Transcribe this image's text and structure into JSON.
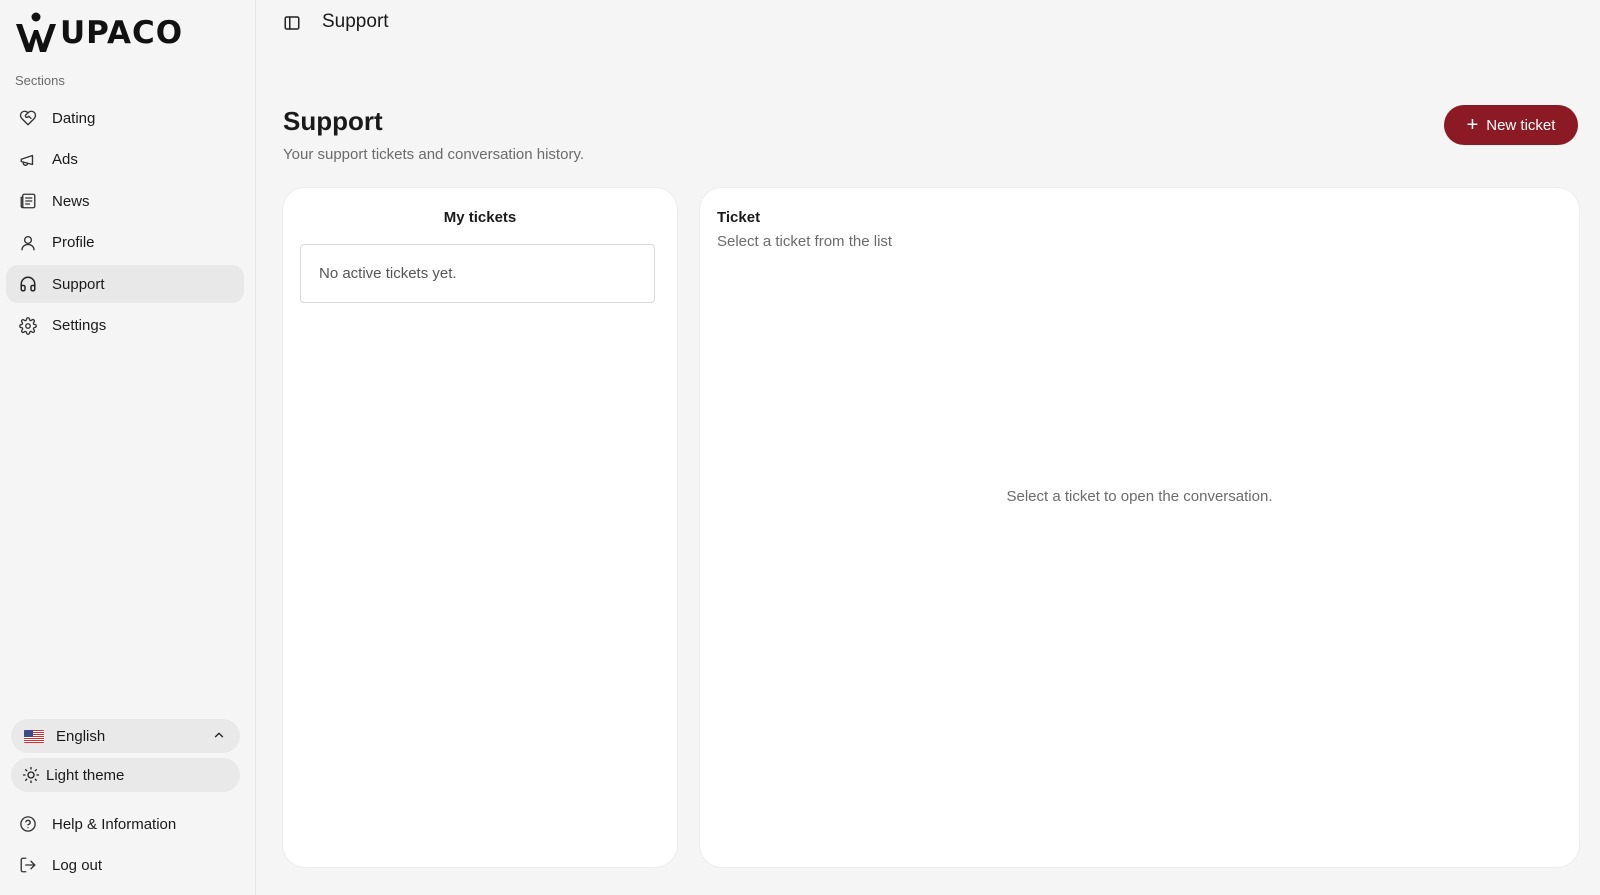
{
  "brand": {
    "logo_text": "UPACO"
  },
  "sidebar": {
    "sections_label": "Sections",
    "items": [
      {
        "label": "Dating",
        "icon": "heart-handshake-icon"
      },
      {
        "label": "Ads",
        "icon": "megaphone-icon"
      },
      {
        "label": "News",
        "icon": "newspaper-icon"
      },
      {
        "label": "Profile",
        "icon": "user-icon"
      },
      {
        "label": "Support",
        "icon": "headphones-icon",
        "active": true
      },
      {
        "label": "Settings",
        "icon": "gear-icon"
      }
    ],
    "language": {
      "label": "English",
      "icon": "us-flag-icon"
    },
    "theme": {
      "label": "Light theme",
      "icon": "sun-icon"
    },
    "bottom_items": [
      {
        "label": "Help & Information",
        "icon": "help-circle-icon"
      },
      {
        "label": "Log out",
        "icon": "logout-icon"
      }
    ]
  },
  "topbar": {
    "title": "Support"
  },
  "page": {
    "title": "Support",
    "subtitle": "Your support tickets and conversation history.",
    "new_ticket_label": "New ticket"
  },
  "tickets_panel": {
    "title": "My tickets",
    "empty_text": "No active tickets yet."
  },
  "ticket_panel": {
    "title": "Ticket",
    "subtitle": "Select a ticket from the list",
    "empty_text": "Select a ticket to open the conversation."
  },
  "colors": {
    "accent": "#8b1a24",
    "background": "#f5f5f5",
    "card": "#ffffff",
    "active_nav": "#e8e8e8"
  }
}
